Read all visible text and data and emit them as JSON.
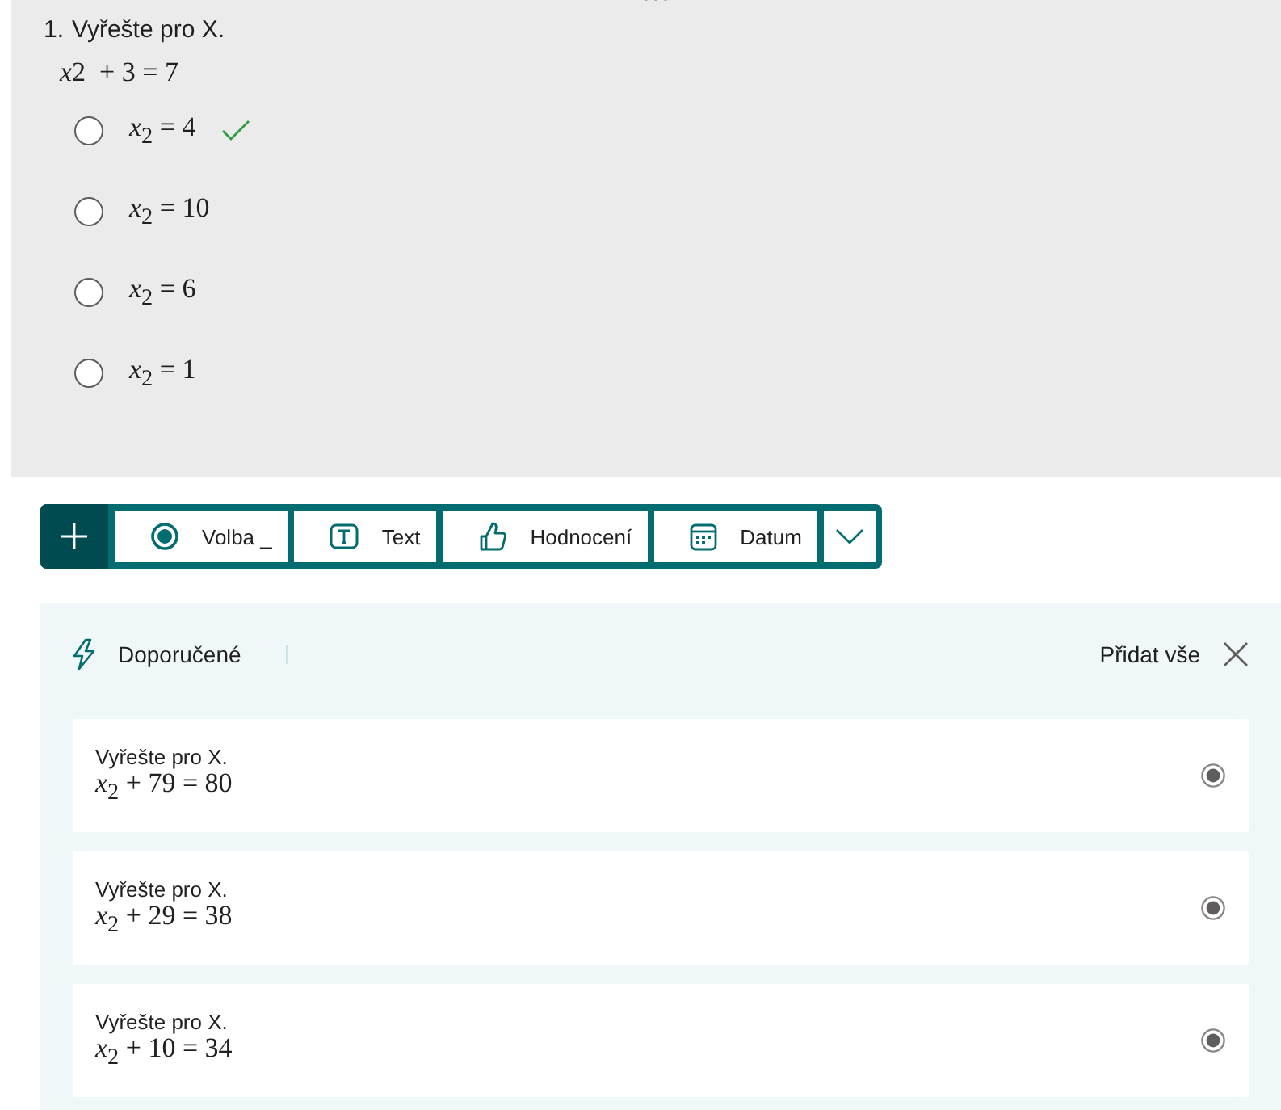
{
  "question": {
    "number": "1.",
    "title": "Vyřešte pro X.",
    "equation": {
      "variable": "x",
      "rest": "2  + 3 = 7"
    },
    "options": [
      {
        "label": "*x*$_{2}$ = 4",
        "selected": false,
        "correct": true
      },
      {
        "label": "*x*$_{2}$ = 10",
        "selected": false,
        "correct": false
      },
      {
        "label": "*x*$_{2}$ = 6",
        "selected": false,
        "correct": false
      },
      {
        "label": "*x*$_{2}$ = 1",
        "selected": false,
        "correct": false
      }
    ]
  },
  "toolbar": {
    "items": [
      {
        "kind": "choice",
        "label": "Volba _"
      },
      {
        "kind": "text",
        "label": "Text"
      },
      {
        "kind": "rating",
        "label": "Hodnocení"
      },
      {
        "kind": "date",
        "label": "Datum"
      }
    ]
  },
  "suggestions": {
    "title": "Doporučené",
    "add_all": "Přidat vše",
    "items": [
      {
        "title": "Vyřešte pro X.",
        "equation": "*x*$_{2}$ + 79 = 80"
      },
      {
        "title": "Vyřešte pro X.",
        "equation": "*x*$_{2}$ + 29 = 38"
      },
      {
        "title": "Vyřešte pro X.",
        "equation": "*x*$_{2}$ + 10 = 34"
      }
    ]
  }
}
